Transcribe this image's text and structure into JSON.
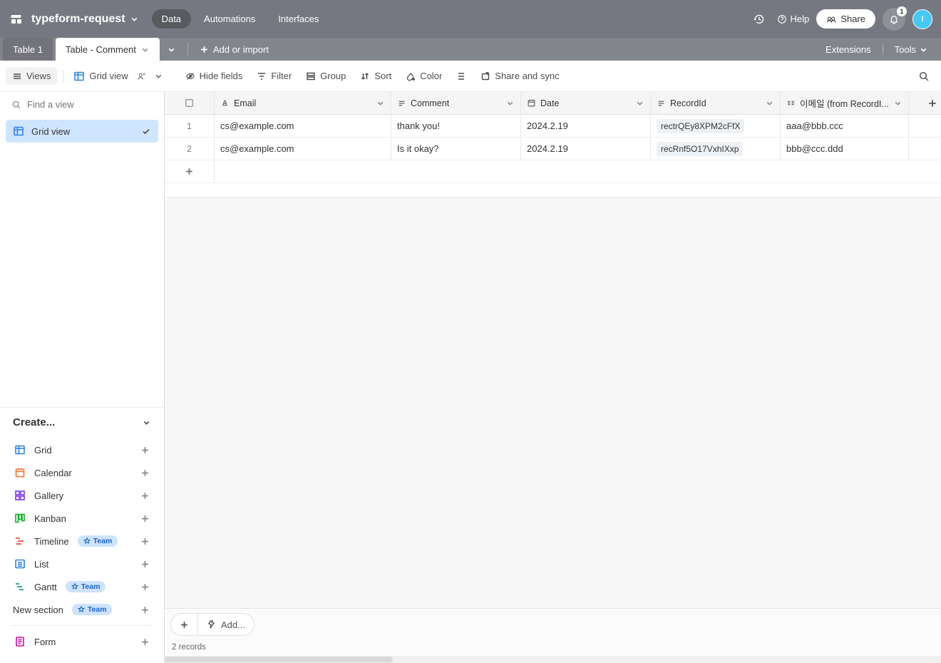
{
  "header": {
    "base_name": "typeform-request",
    "nav": {
      "data": "Data",
      "automations": "Automations",
      "interfaces": "Interfaces"
    },
    "help": "Help",
    "share": "Share",
    "notification_count": "1",
    "avatar_initial": "I"
  },
  "tabs": {
    "tab1": "Table 1",
    "tab2": "Table - Comment",
    "add_or_import": "Add or import",
    "extensions": "Extensions",
    "tools": "Tools"
  },
  "toolbar": {
    "views": "Views",
    "grid_view": "Grid view",
    "hide_fields": "Hide fields",
    "filter": "Filter",
    "group": "Group",
    "sort": "Sort",
    "color": "Color",
    "share_sync": "Share and sync"
  },
  "sidebar": {
    "find_placeholder": "Find a view",
    "view_name": "Grid view",
    "create_label": "Create...",
    "items": {
      "grid": "Grid",
      "calendar": "Calendar",
      "gallery": "Gallery",
      "kanban": "Kanban",
      "timeline": "Timeline",
      "list": "List",
      "gantt": "Gantt",
      "new_section": "New section",
      "form": "Form"
    },
    "team_badge": "Team"
  },
  "columns": {
    "email": "Email",
    "comment": "Comment",
    "date": "Date",
    "record_id": "RecordId",
    "linked_email": "이메일 (from RecordI..."
  },
  "rows": [
    {
      "n": "1",
      "email": "cs@example.com",
      "comment": "thank you!",
      "date": "2024.2.19",
      "record_id": "rectrQEy8XPM2cFfX",
      "linked_email": "aaa@bbb.ccc"
    },
    {
      "n": "2",
      "email": "cs@example.com",
      "comment": "Is it okay?",
      "date": "2024.2.19",
      "record_id": "recRnf5O17VxhIXxp",
      "linked_email": "bbb@ccc.ddd"
    }
  ],
  "footer": {
    "add": "Add...",
    "record_count": "2 records"
  }
}
